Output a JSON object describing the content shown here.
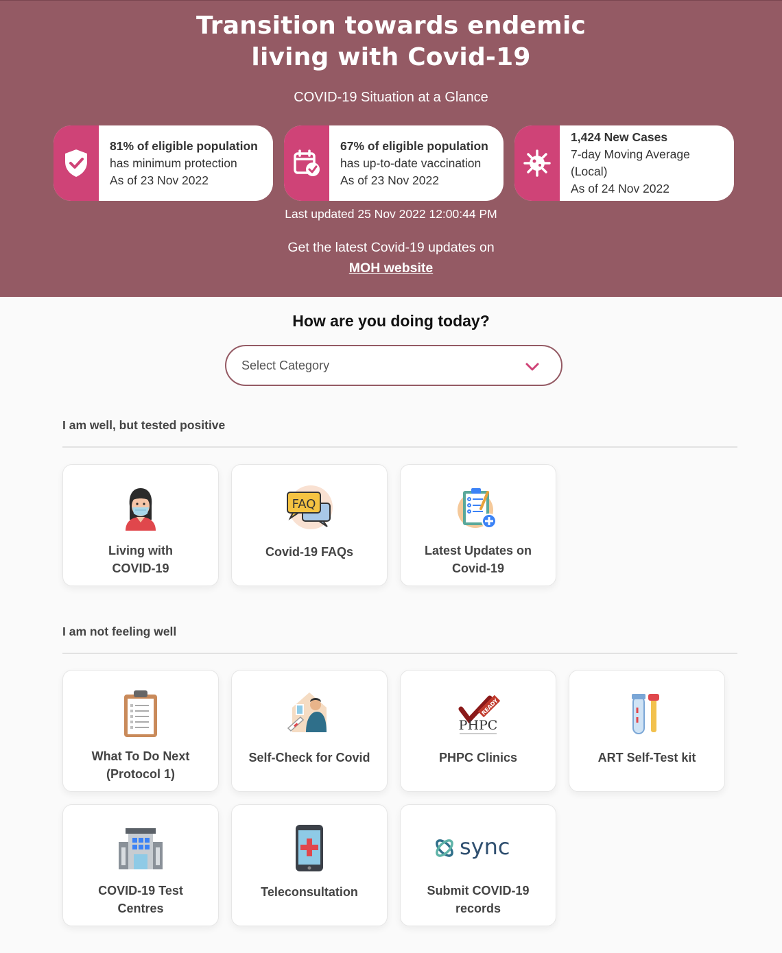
{
  "hero": {
    "title_line1": "Transition towards endemic",
    "title_line2": "living with Covid-19",
    "subtitle": "COVID-19 Situation at a Glance",
    "stats": [
      {
        "icon": "shield-check-icon",
        "line1": "81% of eligible population",
        "line2": "has minimum protection",
        "line3": "As of 23 Nov 2022"
      },
      {
        "icon": "calendar-check-icon",
        "line1": "67% of eligible population",
        "line2": "has up-to-date vaccination",
        "line3": "As of 23 Nov 2022"
      },
      {
        "icon": "virus-icon",
        "line1": "1,424 New Cases",
        "line2": "7-day Moving Average",
        "line3": "(Local)",
        "line4": "As of 24 Nov 2022"
      }
    ],
    "last_updated": "Last updated 25 Nov 2022 12:00:44 PM",
    "latest_text": "Get the latest Covid-19 updates on",
    "moh_link": "MOH website"
  },
  "category": {
    "question": "How are you doing today?",
    "select_placeholder": "Select Category"
  },
  "sections": [
    {
      "title": "I am well, but tested positive",
      "cards": [
        {
          "icon": "woman-mask-icon",
          "line1": "Living with",
          "line2": "COVID-19"
        },
        {
          "icon": "faq-icon",
          "line1": "Covid-19 FAQs"
        },
        {
          "icon": "clipboard-updates-icon",
          "line1": "Latest Updates on",
          "line2": "Covid-19"
        }
      ]
    },
    {
      "title": "I am not feeling well",
      "cards": [
        {
          "icon": "clipboard-checklist-icon",
          "line1": "What To Do Next",
          "line2": "(Protocol 1)"
        },
        {
          "icon": "self-check-icon",
          "line1": "Self-Check for Covid"
        },
        {
          "icon": "phpc-logo-icon",
          "line1": "PHPC Clinics",
          "logo_text": "PHPC",
          "badge_text": "READY"
        },
        {
          "icon": "test-tube-icon",
          "line1": "ART Self-Test kit"
        },
        {
          "icon": "test-centre-building-icon",
          "line1": "COVID-19 Test",
          "line2": "Centres"
        },
        {
          "icon": "phone-medical-icon",
          "line1": "Teleconsultation"
        },
        {
          "icon": "sync-logo-icon",
          "line1": "Submit COVID-19",
          "line2": "records",
          "logo_text": "sync"
        }
      ]
    }
  ],
  "colors": {
    "hero_bg": "#945a64",
    "accent_pink": "#cf4377"
  }
}
